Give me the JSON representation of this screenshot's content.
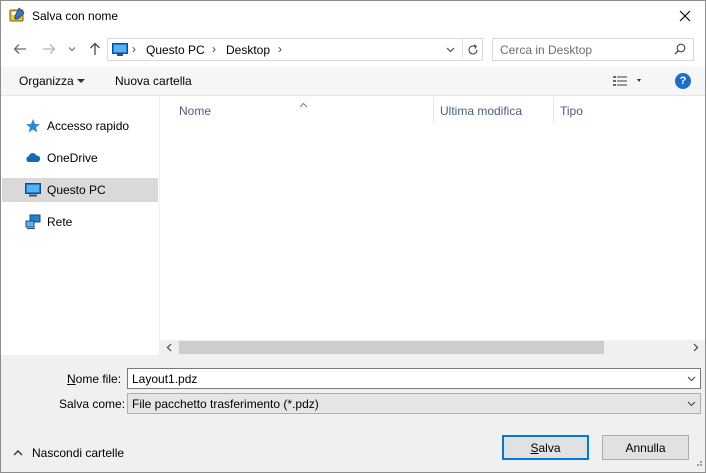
{
  "window": {
    "title": "Salva con nome",
    "icon": "save-dialog-app-icon"
  },
  "address": {
    "breadcrumbs": [
      "Questo PC",
      "Desktop"
    ],
    "search_placeholder": "Cerca in Desktop"
  },
  "toolbar": {
    "organize_label": "Organizza",
    "new_folder_label": "Nuova cartella",
    "help_label": "?"
  },
  "nav": {
    "items": [
      {
        "label": "Accesso rapido",
        "icon": "star-icon"
      },
      {
        "label": "OneDrive",
        "icon": "cloud-icon"
      },
      {
        "label": "Questo PC",
        "icon": "computer-icon",
        "selected": true
      },
      {
        "label": "Rete",
        "icon": "network-icon"
      }
    ]
  },
  "file_list": {
    "columns": [
      "Nome",
      "Ultima modifica",
      "Tipo"
    ]
  },
  "form": {
    "filename_label": "Nome file:",
    "filename_value": "Layout1.pdz",
    "savetype_label": "Salva come:",
    "savetype_value": "File pacchetto trasferimento (*.pdz)"
  },
  "footer": {
    "hide_folders_label": "Nascondi cartelle",
    "save_label": "Salva",
    "cancel_label": "Annulla"
  },
  "colors": {
    "accent": "#0078d7",
    "selection": "#d9d9d9",
    "help_blue": "#1e6fc4"
  }
}
